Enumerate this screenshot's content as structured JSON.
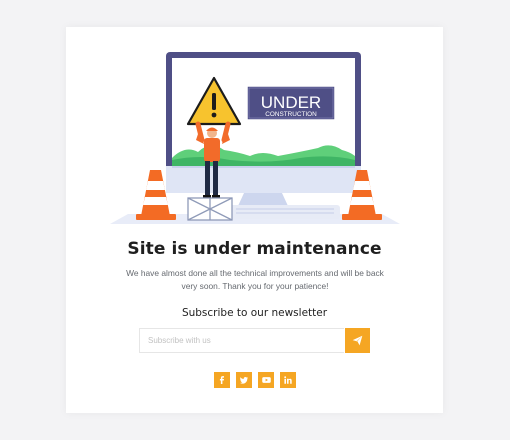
{
  "sign": {
    "line1": "UNDER",
    "line2": "CONSTRUCTION"
  },
  "heading": "Site is under maintenance",
  "description": {
    "line1": "We have almost done all the technical improvements and will be back",
    "line2": "very soon. Thank you for your patience!"
  },
  "newsletter": {
    "title": "Subscribe to our newsletter",
    "placeholder": "Subscribe with us",
    "submit_icon": "paper-plane-icon"
  },
  "social": [
    {
      "name": "facebook",
      "glyph": "f",
      "icon": "facebook-icon"
    },
    {
      "name": "twitter",
      "glyph": "",
      "icon": "twitter-icon"
    },
    {
      "name": "youtube",
      "glyph": "",
      "icon": "youtube-icon"
    },
    {
      "name": "linkedin",
      "glyph": "in",
      "icon": "linkedin-icon"
    }
  ],
  "colors": {
    "accent": "#f5a623",
    "monitor_frame": "#4f4f86",
    "sign_bg": "#4f4f86",
    "warning_yellow": "#f7c32e",
    "worker_orange": "#f26b2a",
    "cone_orange": "#f36b24",
    "grass_green": "#5fcf7a"
  }
}
